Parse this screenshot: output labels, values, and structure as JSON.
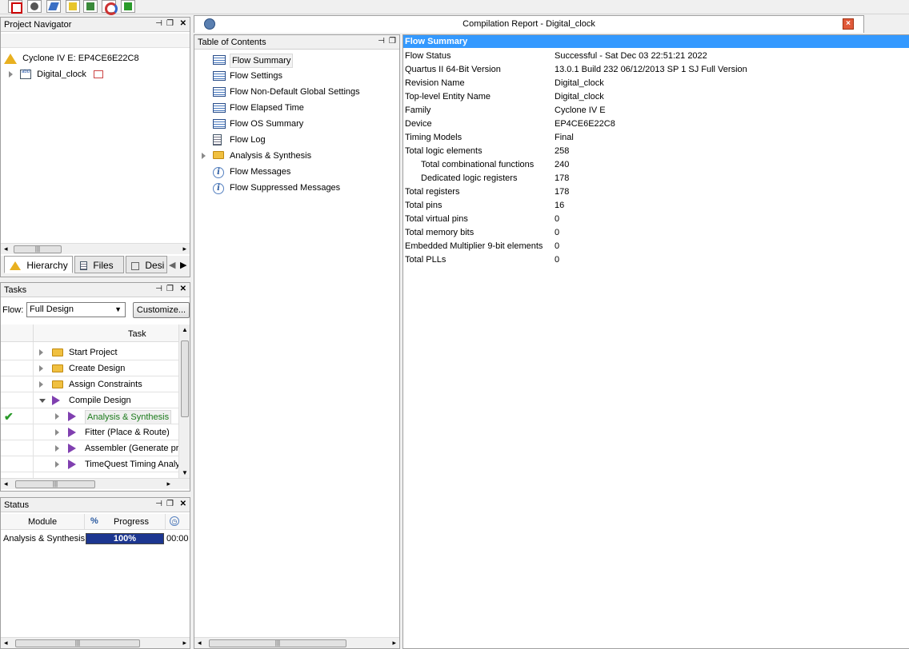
{
  "toolbar": {
    "buttons": [
      {
        "icon": "stop-compile-icon"
      },
      {
        "icon": "analyzer-icon"
      },
      {
        "icon": "edit-icon"
      },
      {
        "icon": "assignment-icon"
      },
      {
        "icon": "chip-planner-icon"
      },
      {
        "icon": "rtl-viewer-icon"
      },
      {
        "icon": "programmer-icon"
      }
    ]
  },
  "project_navigator": {
    "title": "Project Navigator",
    "device": "Cyclone IV E: EP4CE6E22C8",
    "entity": "Digital_clock",
    "tabs": [
      "Hierarchy",
      "Files",
      "Desi"
    ]
  },
  "tasks": {
    "title": "Tasks",
    "flow_label": "Flow:",
    "flow_value": "Full Design",
    "customize_label": "Customize...",
    "column_task": "Task",
    "items": [
      {
        "label": "Start Project",
        "level": 1,
        "icon": "folder"
      },
      {
        "label": "Create Design",
        "level": 1,
        "icon": "folder"
      },
      {
        "label": "Assign Constraints",
        "level": 1,
        "icon": "folder"
      },
      {
        "label": "Compile Design",
        "level": 1,
        "icon": "play",
        "expanded": true
      },
      {
        "label": "Analysis & Synthesis",
        "level": 2,
        "icon": "play",
        "done": true
      },
      {
        "label": "Fitter (Place & Route)",
        "level": 2,
        "icon": "play"
      },
      {
        "label": "Assembler (Generate pr",
        "level": 2,
        "icon": "play"
      },
      {
        "label": "TimeQuest Timing Analy",
        "level": 2,
        "icon": "play"
      }
    ]
  },
  "status_panel": {
    "title": "Status",
    "col_module": "Module",
    "col_percent": "%",
    "col_progress": "Progress",
    "row_module": "Analysis & Synthesis",
    "row_progress_label": "100%",
    "row_progress_fraction": 1.0,
    "row_time": "00:00"
  },
  "report": {
    "title": "Compilation Report - Digital_clock"
  },
  "toc": {
    "title": "Table of Contents",
    "items": [
      {
        "label": "Flow Summary",
        "icon": "table",
        "selected": true
      },
      {
        "label": "Flow Settings",
        "icon": "table"
      },
      {
        "label": "Flow Non-Default Global Settings",
        "icon": "table"
      },
      {
        "label": "Flow Elapsed Time",
        "icon": "table"
      },
      {
        "label": "Flow OS Summary",
        "icon": "table"
      },
      {
        "label": "Flow Log",
        "icon": "doc"
      },
      {
        "label": "Analysis & Synthesis",
        "icon": "folder",
        "expandable": true
      },
      {
        "label": "Flow Messages",
        "icon": "info"
      },
      {
        "label": "Flow Suppressed Messages",
        "icon": "info"
      }
    ]
  },
  "flow_summary": {
    "header": "Flow Summary",
    "rows": [
      {
        "label": "Flow Status",
        "value": "Successful - Sat Dec 03 22:51:21 2022",
        "indent": false
      },
      {
        "label": "Quartus II 64-Bit Version",
        "value": "13.0.1 Build 232 06/12/2013 SP 1 SJ Full Version",
        "indent": false
      },
      {
        "label": "Revision Name",
        "value": "Digital_clock",
        "indent": false
      },
      {
        "label": "Top-level Entity Name",
        "value": "Digital_clock",
        "indent": false
      },
      {
        "label": "Family",
        "value": "Cyclone IV E",
        "indent": false
      },
      {
        "label": "Device",
        "value": "EP4CE6E22C8",
        "indent": false
      },
      {
        "label": "Timing Models",
        "value": "Final",
        "indent": false
      },
      {
        "label": "Total logic elements",
        "value": "258",
        "indent": false
      },
      {
        "label": "Total combinational functions",
        "value": "240",
        "indent": true
      },
      {
        "label": "Dedicated logic registers",
        "value": "178",
        "indent": true
      },
      {
        "label": "Total registers",
        "value": "178",
        "indent": false
      },
      {
        "label": "Total pins",
        "value": "16",
        "indent": false
      },
      {
        "label": "Total virtual pins",
        "value": "0",
        "indent": false
      },
      {
        "label": "Total memory bits",
        "value": "0",
        "indent": false
      },
      {
        "label": "Embedded Multiplier 9-bit elements",
        "value": "0",
        "indent": false
      },
      {
        "label": "Total PLLs",
        "value": "0",
        "indent": false
      }
    ]
  },
  "colors": {
    "header_blue": "#3399ff",
    "progress_blue": "#1c3690",
    "checkmark_green": "#2a9a2a"
  }
}
